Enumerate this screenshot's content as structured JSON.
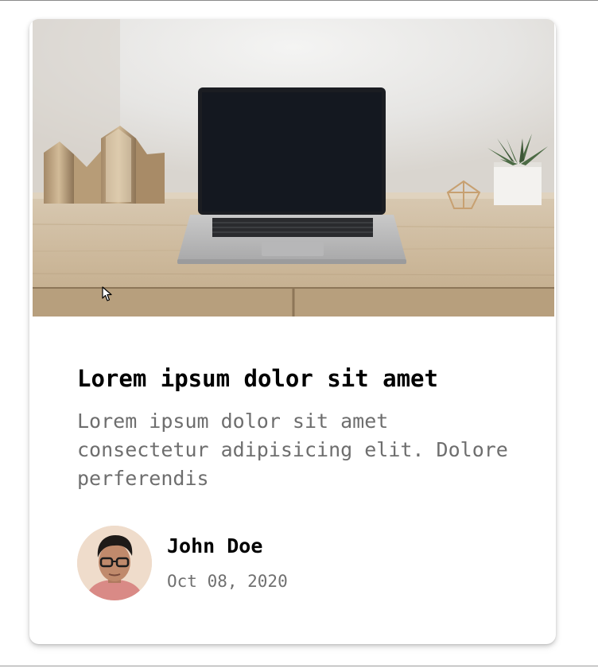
{
  "card": {
    "title": "Lorem ipsum dolor sit amet",
    "excerpt": "Lorem ipsum dolor sit amet consectetur adipisicing elit. Dolore perferendis",
    "author": {
      "name": "John Doe",
      "date": "Oct 08, 2020"
    }
  },
  "images": {
    "hero": "laptop-on-desk-photo",
    "avatar": "author-portrait-photo"
  },
  "colors": {
    "title": "#000000",
    "excerpt": "#6e6e6e",
    "date": "#707070",
    "card_bg": "#ffffff"
  }
}
